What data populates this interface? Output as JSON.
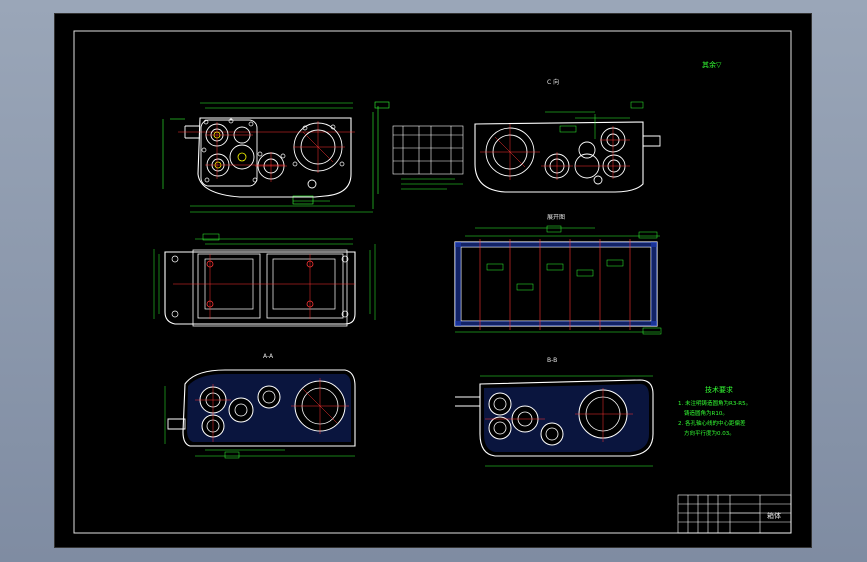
{
  "drawing": {
    "roughness_mark": "其余▽",
    "view_c_title": "C 向",
    "view_top_section_title": "展开图",
    "view_aa_title": "A-A",
    "view_bb_title": "B-B",
    "tech_req": {
      "title": "技术要求",
      "line1": "1. 未注明铸造圆角为R3-R5。",
      "line2": "铸造圆角为R10。",
      "line3": "2. 各孔轴心线的中心距偏差",
      "line4": "方向平行度为0.03。"
    },
    "title_block": {
      "part_name": "箱体"
    }
  },
  "colors": {
    "background": "#000000",
    "outline": "#ffffff",
    "dimension": "#33ff33",
    "center_line": "#ff3333",
    "hatch": "#3366ff",
    "highlight": "#ffff00"
  }
}
